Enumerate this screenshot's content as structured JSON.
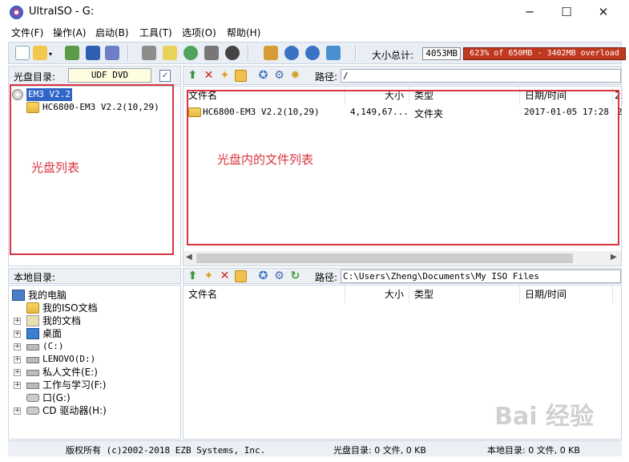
{
  "window": {
    "title": "UltraISO - G:",
    "minimize_glyph": "─",
    "maximize_glyph": "☐",
    "close_glyph": "✕"
  },
  "menu": [
    "文件(F)",
    "操作(A)",
    "启动(B)",
    "工具(T)",
    "选项(O)",
    "帮助(H)"
  ],
  "toolbar": {
    "size_label": "大小总计:",
    "size_value": "4053MB",
    "overload_text": "623% of 650MB - 3402MB overload",
    "overload_color": "#c0381f"
  },
  "disc": {
    "dir_label": "光盘目录:",
    "volume_label": "UDF DVD",
    "path_label": "路径:",
    "path": "/",
    "tree": [
      {
        "label": "EM3 V2.2",
        "selected": true
      },
      {
        "label": "HC6800-EM3 V2.2(10,29)"
      }
    ],
    "columns": [
      "文件名",
      "大小",
      "类型",
      "日期/时间",
      "2"
    ],
    "files": [
      {
        "name": "HC6800-EM3 V2.2(10,29)",
        "size": "4,149,67...",
        "type": "文件夹",
        "date": "2017-01-05 17:28",
        "extra": "2"
      }
    ]
  },
  "annotations": {
    "disc_list": "光盘列表",
    "disc_files": "光盘内的文件列表",
    "box_color": "#d9343f"
  },
  "local": {
    "dir_label": "本地目录:",
    "path_label": "路径:",
    "path": "C:\\Users\\Zheng\\Documents\\My ISO Files",
    "tree": [
      {
        "label": "我的电脑",
        "icon": "computer-icon"
      },
      {
        "label": "我的ISO文档",
        "icon": "iso-folder-icon"
      },
      {
        "label": "我的文档",
        "icon": "documents-icon"
      },
      {
        "label": "桌面",
        "icon": "desktop-icon"
      },
      {
        "label": "(C:)",
        "icon": "drive-icon"
      },
      {
        "label": "LENOVO(D:)",
        "icon": "drive-icon"
      },
      {
        "label": "私人文件(E:)",
        "icon": "drive-icon"
      },
      {
        "label": "工作与学习(F:)",
        "icon": "drive-icon"
      },
      {
        "label": "口(G:)",
        "icon": "cd-drive-icon"
      },
      {
        "label": "CD 驱动器(H:)",
        "icon": "cd-drive-icon"
      }
    ],
    "columns": [
      "文件名",
      "大小",
      "类型",
      "日期/时间"
    ]
  },
  "status": {
    "copyright": "版权所有 (c)2002-2018 EZB Systems, Inc.",
    "disc_summary": "光盘目录: 0 文件, 0 KB",
    "local_summary": "本地目录: 0 文件, 0 KB"
  },
  "watermark": "Bai 经验"
}
